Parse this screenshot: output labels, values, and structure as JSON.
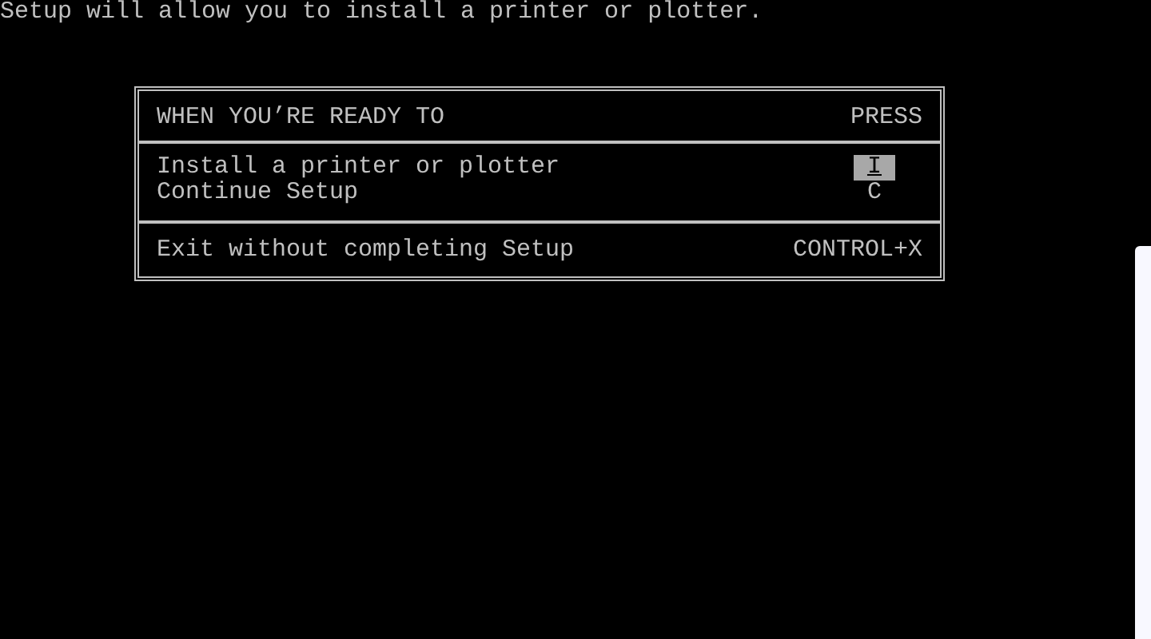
{
  "intro": "Setup will allow you to install a printer or plotter.",
  "header": {
    "action": "WHEN YOU’RE READY TO",
    "key": "PRESS"
  },
  "options": [
    {
      "label": "Install a printer or plotter",
      "key": "I",
      "selected": true
    },
    {
      "label": "Continue Setup",
      "key": "C",
      "selected": false
    }
  ],
  "exit": {
    "label": "Exit without completing Setup",
    "key": "CONTROL+X"
  }
}
